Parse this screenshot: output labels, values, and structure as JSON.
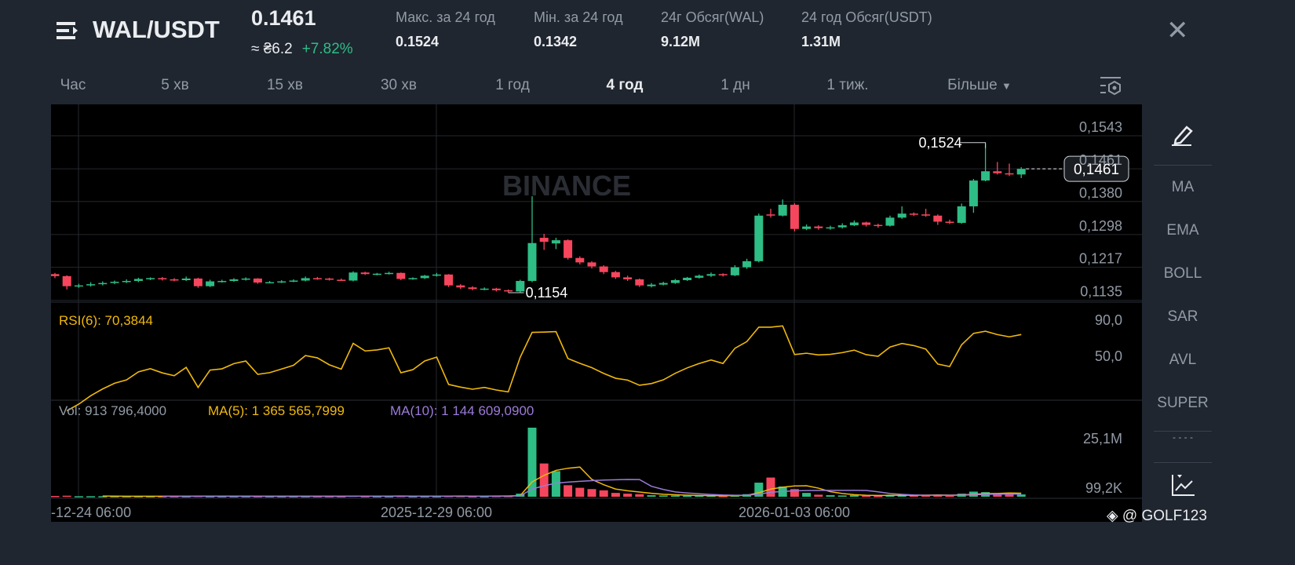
{
  "header": {
    "pair": "WAL/USDT",
    "price": "0.1461",
    "fiat": "≈ ₴6.2",
    "change": "+7.82%",
    "stats": [
      {
        "label": "Макс. за 24 год",
        "value": "0.1524"
      },
      {
        "label": "Мін. за 24 год",
        "value": "0.1342"
      },
      {
        "label": "24г Обсяг(WAL)",
        "value": "9.12M"
      },
      {
        "label": "24 год Обсяг(USDT)",
        "value": "1.31M"
      }
    ]
  },
  "tabs": [
    "Час",
    "5 хв",
    "15 хв",
    "30 хв",
    "1 год",
    "4 год",
    "1 дн",
    "1 тиж.",
    "Більше"
  ],
  "active_tab": "4 год",
  "side": [
    "MA",
    "EMA",
    "BOLL",
    "SAR",
    "AVL",
    "SUPER",
    "- - - -"
  ],
  "watermark": "@ GOLF123",
  "chart_data": {
    "type": "candlestick",
    "watermark": "BINANCE",
    "price_ticks": [
      "0,1543",
      "0,1461",
      "0,1380",
      "0,1298",
      "0,1217",
      "0,1135"
    ],
    "price_tick_values": [
      0.1543,
      0.1461,
      0.138,
      0.1298,
      0.1217,
      0.1135
    ],
    "current_price": "0,1461",
    "high_label": "0,1524",
    "low_label": "0,1154",
    "rsi_label": "RSI(6): 70,3844",
    "rsi_ticks": [
      "90,0",
      "50,0"
    ],
    "vol_label": "Vol: 913 796,4000",
    "ma5_label": "MA(5): 1 365 565,7999",
    "ma10_label": "MA(10): 1 144 609,0900",
    "vol_ticks": [
      "25,1M",
      "99,2K"
    ],
    "time_labels": [
      "-12-24 06:00",
      "2025-12-29 06:00",
      "2026-01-03 06:00"
    ],
    "colors": {
      "up": "#2ebd85",
      "down": "#f6465d",
      "rsi": "#f0b90b",
      "ma5": "#f0b90b",
      "ma10": "#9b7bd8"
    },
    "ohlc": [
      [
        0.12,
        0.1203,
        0.119,
        0.1195
      ],
      [
        0.1195,
        0.1197,
        0.1162,
        0.117
      ],
      [
        0.117,
        0.1176,
        0.1166,
        0.1172
      ],
      [
        0.1172,
        0.118,
        0.1169,
        0.1175
      ],
      [
        0.1175,
        0.1182,
        0.1172,
        0.1178
      ],
      [
        0.1178,
        0.1184,
        0.1175,
        0.1181
      ],
      [
        0.1181,
        0.1187,
        0.1178,
        0.1183
      ],
      [
        0.1183,
        0.1191,
        0.118,
        0.1188
      ],
      [
        0.1188,
        0.1192,
        0.1185,
        0.119
      ],
      [
        0.119,
        0.1193,
        0.1184,
        0.1187
      ],
      [
        0.1187,
        0.119,
        0.1182,
        0.1185
      ],
      [
        0.1185,
        0.1194,
        0.1183,
        0.1189
      ],
      [
        0.1189,
        0.1191,
        0.1166,
        0.117
      ],
      [
        0.117,
        0.1186,
        0.1168,
        0.1182
      ],
      [
        0.1182,
        0.1186,
        0.1179,
        0.1183
      ],
      [
        0.1183,
        0.119,
        0.1181,
        0.1187
      ],
      [
        0.1187,
        0.1192,
        0.1184,
        0.1189
      ],
      [
        0.1189,
        0.119,
        0.1176,
        0.1179
      ],
      [
        0.1179,
        0.1183,
        0.1177,
        0.118
      ],
      [
        0.118,
        0.1185,
        0.1178,
        0.1182
      ],
      [
        0.1182,
        0.1187,
        0.118,
        0.1184
      ],
      [
        0.1184,
        0.1194,
        0.1182,
        0.119
      ],
      [
        0.119,
        0.1193,
        0.1186,
        0.1189
      ],
      [
        0.1189,
        0.1191,
        0.1184,
        0.1186
      ],
      [
        0.1186,
        0.1189,
        0.1183,
        0.1184
      ],
      [
        0.1184,
        0.1207,
        0.1182,
        0.1204
      ],
      [
        0.1204,
        0.1206,
        0.1198,
        0.12
      ],
      [
        0.12,
        0.1203,
        0.1197,
        0.1201
      ],
      [
        0.1201,
        0.1206,
        0.1199,
        0.1203
      ],
      [
        0.1203,
        0.1204,
        0.1185,
        0.1188
      ],
      [
        0.1188,
        0.1192,
        0.1186,
        0.119
      ],
      [
        0.119,
        0.1198,
        0.1188,
        0.1196
      ],
      [
        0.1196,
        0.1203,
        0.1194,
        0.1199
      ],
      [
        0.1199,
        0.12,
        0.1168,
        0.1172
      ],
      [
        0.1172,
        0.1175,
        0.1163,
        0.1167
      ],
      [
        0.1167,
        0.117,
        0.116,
        0.1163
      ],
      [
        0.1163,
        0.1167,
        0.116,
        0.1164
      ],
      [
        0.1164,
        0.1166,
        0.1157,
        0.116
      ],
      [
        0.116,
        0.1162,
        0.1154,
        0.1157
      ],
      [
        0.1157,
        0.1186,
        0.1155,
        0.1183
      ],
      [
        0.1183,
        0.1393,
        0.118,
        0.1277
      ],
      [
        0.129,
        0.13,
        0.126,
        0.128
      ],
      [
        0.1276,
        0.129,
        0.1262,
        0.1284
      ],
      [
        0.1284,
        0.1286,
        0.1236,
        0.124
      ],
      [
        0.124,
        0.1244,
        0.1224,
        0.1229
      ],
      [
        0.1229,
        0.1232,
        0.1214,
        0.1219
      ],
      [
        0.1219,
        0.1222,
        0.12,
        0.1205
      ],
      [
        0.1205,
        0.1208,
        0.1188,
        0.1192
      ],
      [
        0.1192,
        0.1196,
        0.1183,
        0.1187
      ],
      [
        0.1187,
        0.1189,
        0.1168,
        0.1172
      ],
      [
        0.117,
        0.1178,
        0.1167,
        0.1174
      ],
      [
        0.1174,
        0.1181,
        0.1172,
        0.1178
      ],
      [
        0.1178,
        0.1188,
        0.1176,
        0.1185
      ],
      [
        0.1185,
        0.1193,
        0.1183,
        0.1191
      ],
      [
        0.1191,
        0.1199,
        0.1189,
        0.1196
      ],
      [
        0.1196,
        0.1204,
        0.1193,
        0.12
      ],
      [
        0.12,
        0.1202,
        0.1194,
        0.1197
      ],
      [
        0.1197,
        0.1222,
        0.1195,
        0.1217
      ],
      [
        0.1217,
        0.1238,
        0.1213,
        0.1232
      ],
      [
        0.1232,
        0.135,
        0.1229,
        0.1345
      ],
      [
        0.1348,
        0.1362,
        0.134,
        0.1345
      ],
      [
        0.1345,
        0.1385,
        0.1343,
        0.1372
      ],
      [
        0.1372,
        0.1376,
        0.1306,
        0.1312
      ],
      [
        0.1312,
        0.1323,
        0.1309,
        0.1318
      ],
      [
        0.1318,
        0.1321,
        0.131,
        0.1314
      ],
      [
        0.1314,
        0.132,
        0.131,
        0.1316
      ],
      [
        0.1316,
        0.1326,
        0.1313,
        0.1321
      ],
      [
        0.1321,
        0.1333,
        0.1319,
        0.1328
      ],
      [
        0.1328,
        0.133,
        0.1318,
        0.1322
      ],
      [
        0.1322,
        0.1325,
        0.1315,
        0.132
      ],
      [
        0.132,
        0.1345,
        0.1318,
        0.134
      ],
      [
        0.134,
        0.1368,
        0.1337,
        0.135
      ],
      [
        0.135,
        0.1353,
        0.1344,
        0.1348
      ],
      [
        0.1348,
        0.1362,
        0.1342,
        0.1345
      ],
      [
        0.1345,
        0.1348,
        0.1322,
        0.133
      ],
      [
        0.133,
        0.1335,
        0.1324,
        0.1327
      ],
      [
        0.1327,
        0.1375,
        0.1325,
        0.1368
      ],
      [
        0.1368,
        0.1436,
        0.1352,
        0.1432
      ],
      [
        0.1432,
        0.1524,
        0.143,
        0.1455
      ],
      [
        0.1455,
        0.1478,
        0.1447,
        0.145
      ],
      [
        0.145,
        0.1474,
        0.1443,
        0.1447
      ],
      [
        0.1447,
        0.1465,
        0.1438,
        0.1461
      ]
    ],
    "volume_m": [
      0.3,
      0.4,
      0.2,
      0.2,
      0.2,
      0.2,
      0.2,
      0.2,
      0.2,
      0.2,
      0.2,
      0.2,
      0.3,
      0.2,
      0.2,
      0.2,
      0.2,
      0.2,
      0.2,
      0.2,
      0.2,
      0.2,
      0.2,
      0.2,
      0.2,
      0.4,
      0.2,
      0.2,
      0.2,
      0.3,
      0.2,
      0.2,
      0.2,
      0.3,
      0.3,
      0.2,
      0.2,
      0.3,
      0.3,
      1.2,
      27,
      13,
      10,
      4.5,
      3.5,
      3,
      2.5,
      1.5,
      1.2,
      1.0,
      0.6,
      0.5,
      0.5,
      0.4,
      0.4,
      0.4,
      0.3,
      0.6,
      1.0,
      5.5,
      7.5,
      4.0,
      3.0,
      1.5,
      0.8,
      0.6,
      0.5,
      0.6,
      0.4,
      0.3,
      0.8,
      0.8,
      0.6,
      0.5,
      0.7,
      0.4,
      1.2,
      2.0,
      1.8,
      1.0,
      1.2,
      0.9
    ]
  }
}
